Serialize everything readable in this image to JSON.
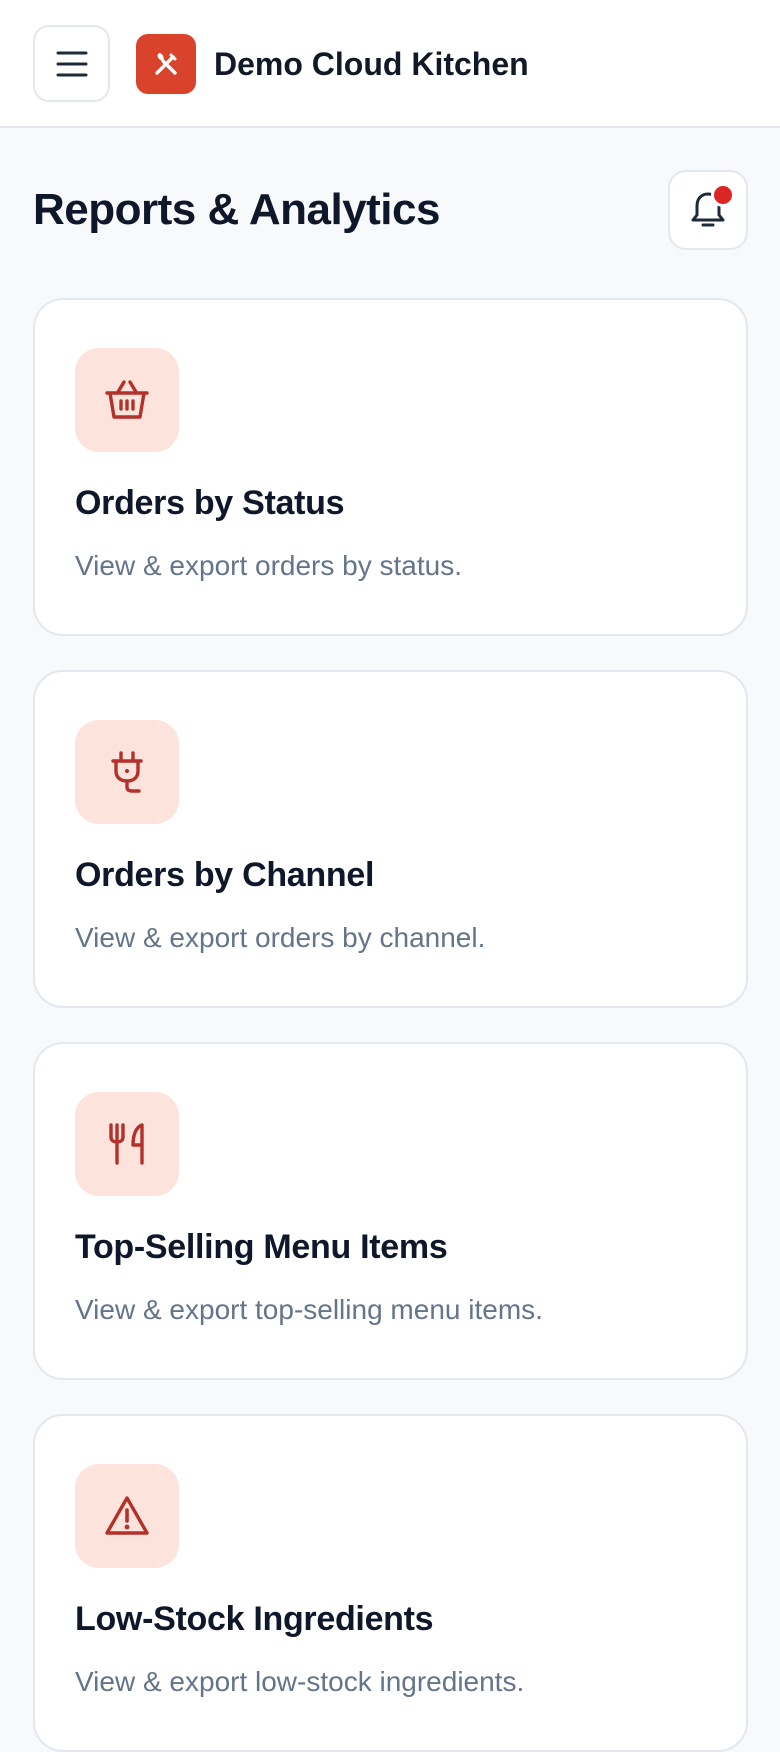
{
  "header": {
    "app_title": "Demo Cloud Kitchen",
    "menu_icon": "hamburger-icon",
    "logo_icon": "utensils-cross-icon"
  },
  "page": {
    "title": "Reports & Analytics",
    "notification_icon": "bell-icon"
  },
  "colors": {
    "accent": "#d9432b",
    "icon_bg": "#fce3dc",
    "icon_fg": "#b4302a",
    "badge": "#dc2626"
  },
  "reports": [
    {
      "title": "Orders by Status",
      "description": "View & export orders by status.",
      "icon": "basket-icon"
    },
    {
      "title": "Orders by Channel",
      "description": "View & export orders by channel.",
      "icon": "plug-icon"
    },
    {
      "title": "Top-Selling Menu Items",
      "description": "View & export top-selling menu items.",
      "icon": "fork-knife-icon"
    },
    {
      "title": "Low-Stock Ingredients",
      "description": "View & export low-stock ingredients.",
      "icon": "warning-icon"
    }
  ]
}
